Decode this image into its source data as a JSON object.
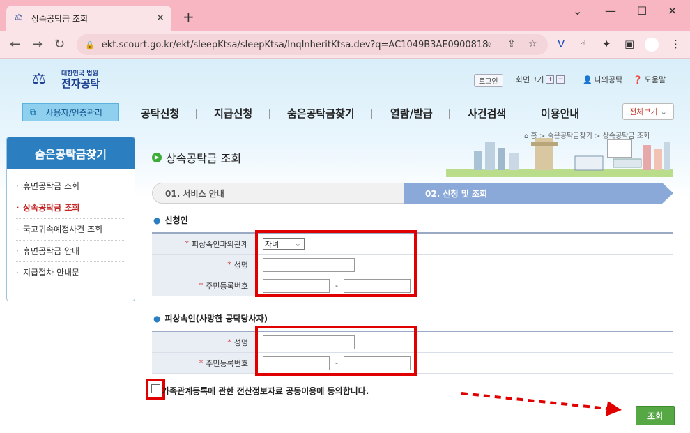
{
  "browser": {
    "tab_title": "상속공탁금 조회",
    "url": "ekt.scourt.go.kr/ekt/sleepKtsa/sleepKtsa/InqInheritKtsa.dev?q=AC1049B3AE0900818..."
  },
  "header": {
    "logo_sub": "대한민국 법원",
    "logo_main": "전자공탁",
    "login": "로그인",
    "zoom_label": "화면크기",
    "zoom_plus": "+",
    "zoom_minus": "−",
    "my_deposit": "나의공탁",
    "help": "도움말"
  },
  "menu": {
    "user_mgmt": "사용자/인증관리",
    "items": [
      "공탁신청",
      "지급신청",
      "숨은공탁금찾기",
      "열람/발급",
      "사건검색",
      "이용안내"
    ],
    "all_view": "전체보기"
  },
  "sidebar": {
    "title": "숨은공탁금찾기",
    "items": [
      "휴면공탁금 조회",
      "상속공탁금 조회",
      "국고귀속예정사건 조회",
      "휴면공탁금 안내",
      "지급절차 안내문"
    ],
    "active_index": 1
  },
  "breadcrumb": "홈 > 숨은공탁금찾기 > 상속공탁금 조회",
  "page_title": "상속공탁금 조회",
  "steps": {
    "step1": "01. 서비스 안내",
    "step2": "02. 신청 및 조회"
  },
  "applicant": {
    "section_title": "신청인",
    "relation_label": "피상속인과의관계",
    "relation_value": "자녀",
    "name_label": "성명",
    "rrn_label": "주민등록번호",
    "dash": "-"
  },
  "deceased": {
    "section_title": "피상속인(사망한 공탁당사자)",
    "name_label": "성명",
    "rrn_label": "주민등록번호",
    "dash": "-"
  },
  "agreement": "가족관계등록에 관한 전산정보자료 공동이용에 동의합니다.",
  "query_button": "조회",
  "colors": {
    "tab_bg": "#f8b6c2",
    "sidebar_head": "#2b7fc1",
    "active_red": "#c62828",
    "annotation_red": "#e00000",
    "query_green": "#56a845"
  }
}
